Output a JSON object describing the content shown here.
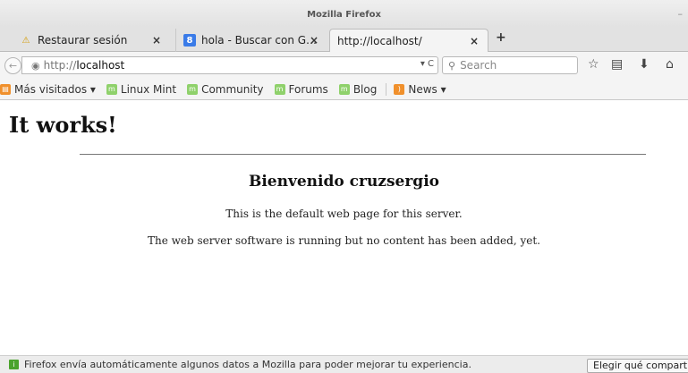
{
  "window": {
    "title": "Mozilla Firefox",
    "minimize_glyph": "–"
  },
  "tabs": [
    {
      "label": "Restaurar sesión",
      "icon": "warning-icon",
      "close": "×"
    },
    {
      "label": "hola - Buscar con G…",
      "icon": "google-icon",
      "icon_text": "8",
      "close": "×"
    },
    {
      "label": "http://localhost/",
      "icon": "none",
      "close": "×",
      "active": true
    }
  ],
  "new_tab_glyph": "+",
  "navbar": {
    "back_glyph": "←",
    "url_prefix": "http://",
    "url_host": "localhost",
    "url_controls": "▾ C",
    "search_placeholder": "Search",
    "icons": [
      "star-icon",
      "reading-list-icon",
      "download-icon",
      "home-icon"
    ]
  },
  "bookmarks": [
    {
      "label": "Más visitados ▾",
      "icon": "most-visited-icon"
    },
    {
      "label": "Linux Mint",
      "icon": "mint-icon"
    },
    {
      "label": "Community",
      "icon": "mint-icon"
    },
    {
      "label": "Forums",
      "icon": "mint-icon"
    },
    {
      "label": "Blog",
      "icon": "mint-icon"
    },
    {
      "label": "News ▾",
      "icon": "rss-icon"
    }
  ],
  "page": {
    "heading": "It works!",
    "subheading": "Bienvenido cruzsergio",
    "paragraph1": "This is the default web page for this server.",
    "paragraph2": "The web server software is running but no content has been added, yet."
  },
  "notification": {
    "text": "Firefox envía automáticamente algunos datos a Mozilla para poder mejorar tu experiencia.",
    "button_label": "Elegir qué compartir"
  },
  "colors": {
    "accent_mint": "#8fd16b",
    "rss_orange": "#f0902c",
    "google_blue": "#3a7be8"
  }
}
